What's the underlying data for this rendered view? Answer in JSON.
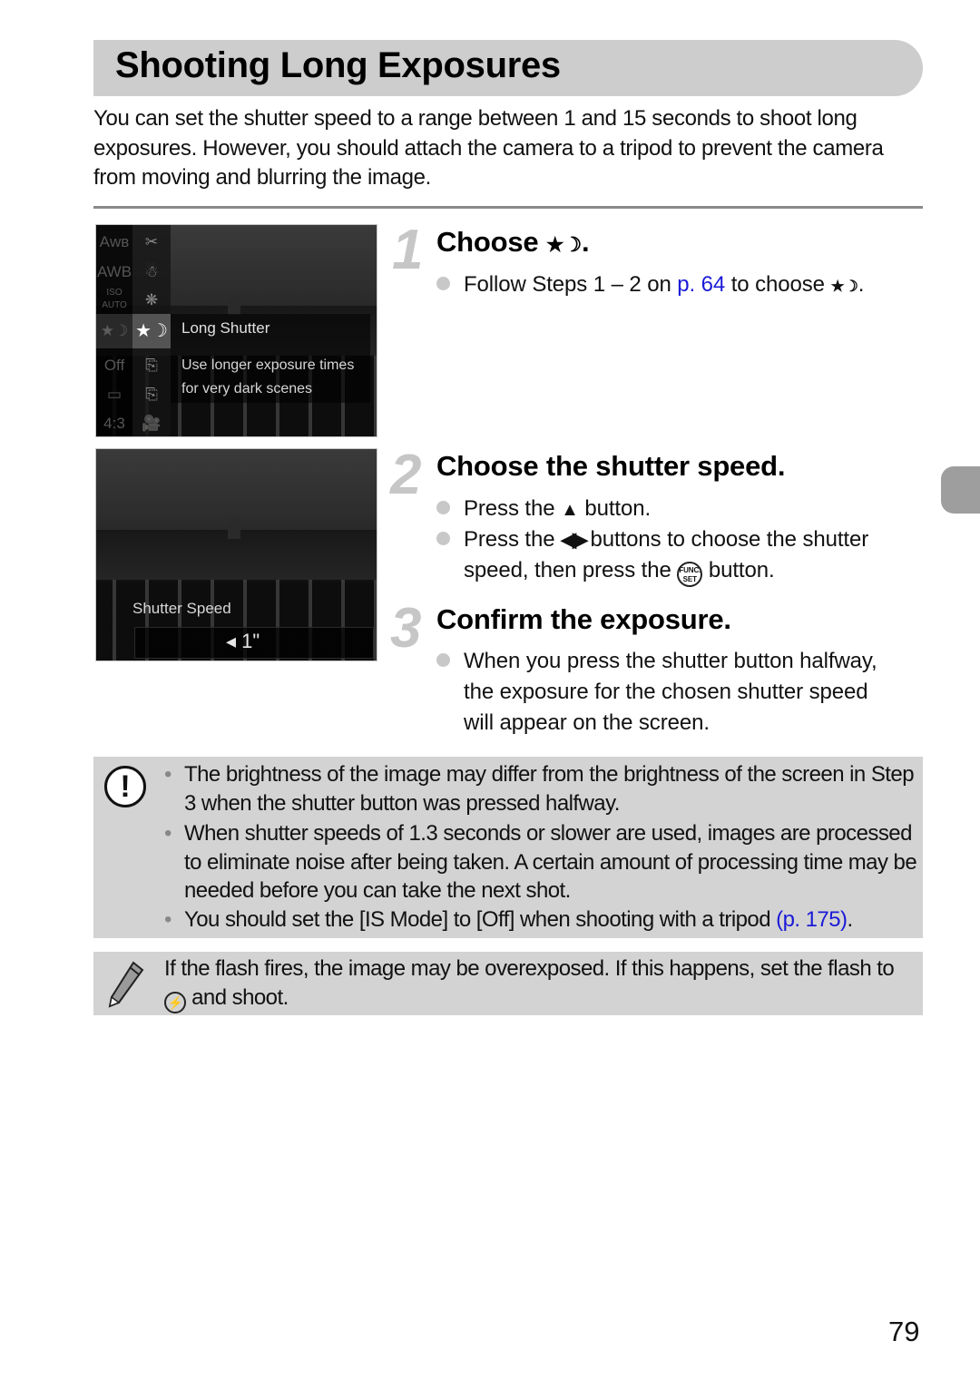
{
  "page": {
    "title": "Shooting Long Exposures",
    "intro": "You can set the shutter speed to a range between 1 and 15 seconds to shoot long exposures. However, you should attach the camera to a tripod to prevent the camera from moving and blurring the image.",
    "page_number": "79"
  },
  "screen1": {
    "menu_col1_icons": [
      "Aᴡʙ",
      "AWB",
      "ISO AUTO",
      "★☽",
      "Off",
      "▭",
      "4:3"
    ],
    "menu_col2_icons": [
      "✂",
      "☃",
      "❋",
      "★☽",
      "⎘",
      "⎘",
      "🎥"
    ],
    "selected_title": "Long Shutter",
    "selected_desc": "Use longer exposure times for very dark scenes"
  },
  "screen2": {
    "label": "Shutter Speed",
    "value": "◂ 1\""
  },
  "steps": [
    {
      "number": "1",
      "heading": "Choose",
      "heading_icon": "★☽",
      "heading_end": ".",
      "bullets": [
        {
          "pre": "Follow Steps 1 – 2 on ",
          "link": "p. 64",
          "post": " to choose ",
          "icon": "★☽",
          "end": "."
        }
      ]
    },
    {
      "number": "2",
      "heading": "Choose the shutter speed.",
      "bullets": [
        {
          "pre": "Press the ",
          "icon": "▲",
          "post": " button."
        },
        {
          "pre": "Press the ",
          "icon": "◀▶",
          "post": " buttons to choose the shutter speed, then press the ",
          "func_top": "FUNC.",
          "func_bottom": "SET",
          "end": " button."
        }
      ]
    },
    {
      "number": "3",
      "heading": "Confirm the exposure.",
      "bullets": [
        {
          "text": "When you press the shutter button halfway, the exposure for the chosen shutter speed will appear on the screen."
        }
      ]
    }
  ],
  "caution": {
    "icon": "!",
    "bullet_char": "•",
    "items": [
      {
        "text": "The brightness of the image may differ from the brightness of the screen in Step 3 when the shutter button was pressed halfway."
      },
      {
        "text": "When shutter speeds of 1.3 seconds or slower are used, images are processed to eliminate noise after being taken. A certain amount of processing time may be needed before you can take the next shot."
      },
      {
        "text": "You should set the [IS Mode] to [Off] when shooting with a tripod ",
        "link": "(p. 175)",
        "end": "."
      }
    ]
  },
  "memo": {
    "pre": "If the flash fires, the image may be overexposed. If this happens, set the flash to ",
    "icon": "⚡",
    "post": " and shoot."
  },
  "colors": {
    "link": "#1a1ad8",
    "title_bar": "#cdcdcd",
    "note_bg": "#d3d3d3",
    "side_tab": "#9e9e9e"
  }
}
